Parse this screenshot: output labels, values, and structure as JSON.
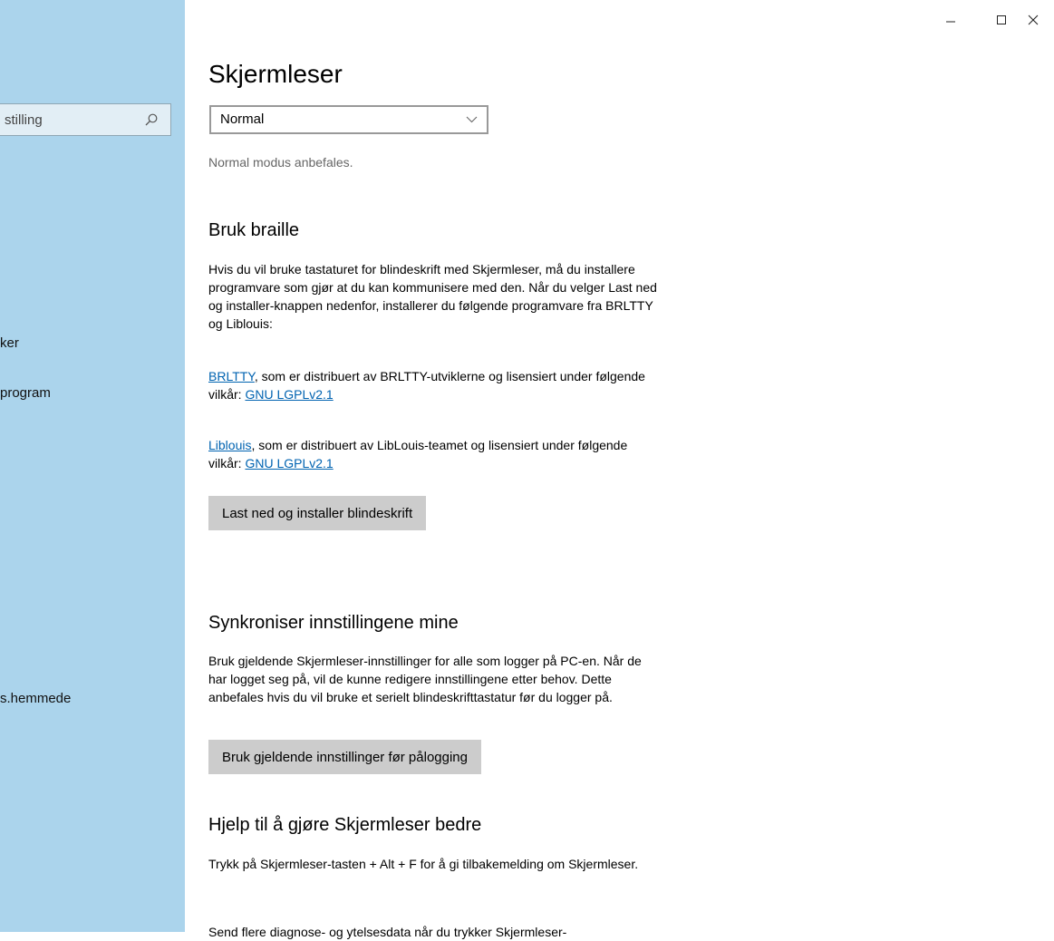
{
  "window": {
    "minimize_label": "–",
    "maximize_label": "☐",
    "close_label": "✕"
  },
  "sidebar": {
    "search_placeholder": "stilling",
    "items": [
      {
        "label": "ker"
      },
      {
        "label": "program"
      },
      {
        "label": "s.hemmede"
      }
    ]
  },
  "main": {
    "title": "Skjermleser",
    "mode_dropdown": {
      "value": "Normal"
    },
    "mode_hint": "Normal modus anbefales.",
    "braille": {
      "heading": "Bruk braille",
      "intro": "Hvis du vil bruke tastaturet for blindeskrift med Skjermleser, må du installere programvare som gjør at du kan kommunisere med den. Når du velger Last ned og installer-knappen nedenfor, installerer du følgende programvare fra BRLTTY og Liblouis:",
      "brltty_link": "BRLTTY",
      "brltty_text": ", som er distribuert av BRLTTY-utviklerne og lisensiert under følgende vilkår: ",
      "brltty_license_link": "GNU LGPLv2.1",
      "liblouis_link": "Liblouis",
      "liblouis_text": ", som er distribuert av LibLouis-teamet og lisensiert under følgende vilkår: ",
      "liblouis_license_link": "GNU LGPLv2.1",
      "install_button": "Last ned og installer blindeskrift"
    },
    "sync": {
      "heading": "Synkroniser innstillingene mine",
      "text": "Bruk gjeldende Skjermleser-innstillinger for alle som logger på PC-en. Når de har logget seg på, vil de kunne redigere innstillingene etter behov. Dette anbefales hvis du vil bruke et serielt blindeskrifttastatur før du logger på.",
      "button": "Bruk gjeldende innstillinger før pålogging"
    },
    "feedback": {
      "heading": "Hjelp til å gjøre Skjermleser bedre",
      "text": "Trykk på Skjermleser-tasten + Alt + F for å gi tilbakemelding om Skjermleser.",
      "partial_text": "Send flere diagnose- og ytelsesdata når du trykker Skjermleser-"
    }
  },
  "colors": {
    "sidebar_bg": "#abd4ec",
    "link": "#0063b1",
    "button_bg": "#cccccc"
  }
}
